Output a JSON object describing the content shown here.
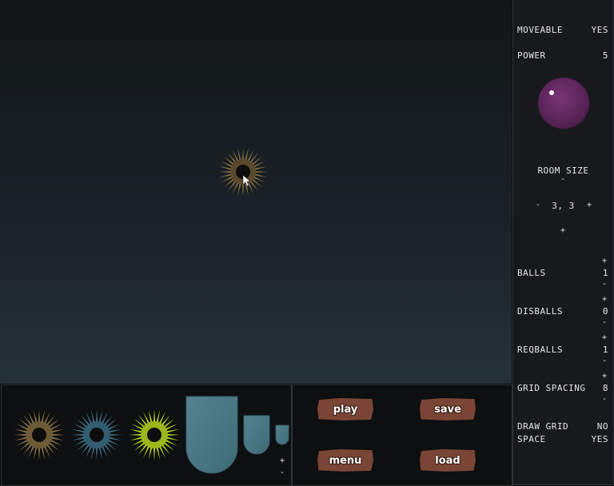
{
  "properties": {
    "moveable": {
      "label": "MOVEABLE",
      "value": "YES"
    },
    "power": {
      "label": "POWER",
      "value": "5"
    },
    "room_size": {
      "label": "ROOM SIZE",
      "value": "3, 3"
    },
    "balls": {
      "label": "BALLS",
      "value": "1"
    },
    "disballs": {
      "label": "DISBALLS",
      "value": "0"
    },
    "reqballs": {
      "label": "REQBALLS",
      "value": "1"
    },
    "grid_spacing": {
      "label": "GRID SPACING",
      "value": "8"
    },
    "draw_grid": {
      "label": "DRAW GRID",
      "value": "NO"
    },
    "space": {
      "label": "SPACE",
      "value": "YES"
    }
  },
  "controls": {
    "plus": "+",
    "minus": "-"
  },
  "buttons": {
    "play": "play",
    "save": "save",
    "menu": "menu",
    "load": "load"
  },
  "palette": {
    "items": [
      "spiky-ball-brown",
      "spiky-ball-blue",
      "spiky-ball-lime",
      "wall-tile-large",
      "wall-tile-medium",
      "wall-tile-small"
    ]
  },
  "colors": {
    "brown_ball": "#8a7146",
    "blue_ball": "#3f6f86",
    "lime_ball": "#b6d31b",
    "tile": "#4d7d8c",
    "power_orb": "#6c2d6a",
    "button_wood": "#7a4535"
  }
}
